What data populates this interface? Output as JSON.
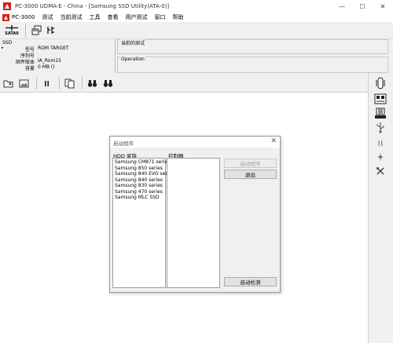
{
  "window": {
    "title": "PC-3000 UDMA-E - China - [Samsung SSD Utility(ATA-0)]",
    "minimize_glyph": "—",
    "maximize_glyph": "☐",
    "close_glyph": "✕"
  },
  "menu": {
    "items": [
      "PC-3000",
      "测试",
      "当前测试",
      "工具",
      "查看",
      "用户测试",
      "窗口",
      "帮助"
    ]
  },
  "toolbar": {
    "sata_label": "SATA0"
  },
  "info_panel": {
    "title": "SSD",
    "rows": [
      {
        "label": "型号",
        "value": "ROM TARGET"
      },
      {
        "label": "序列号",
        "value": ""
      },
      {
        "label": "固件版本",
        "value": "IA_Rom15"
      },
      {
        "label": "容量",
        "value": "0 MB ()"
      }
    ]
  },
  "test_panel": {
    "title": "当前的测试"
  },
  "operation_panel": {
    "title": "Operation"
  },
  "dialog": {
    "title": "启动程序",
    "close_glyph": "✕",
    "hdd_family_label": "HDD 家族",
    "controller_label": "控制器",
    "hdd_families": [
      "Samsung CM871 series",
      "Samsung 850 series",
      "Samsung 840 EVO series",
      "Samsung 840 series",
      "Samsung 830 series",
      "Samsung 470 series",
      "Samsung MLC SSD"
    ],
    "controllers": [],
    "start_button": "启动程序",
    "exit_button": "退出",
    "autodetect_button": "自动检测"
  },
  "colors": {
    "app_icon_red": "#d02020",
    "workspace_bg": "#ffffff",
    "chrome_bg": "#f0f0f0"
  }
}
